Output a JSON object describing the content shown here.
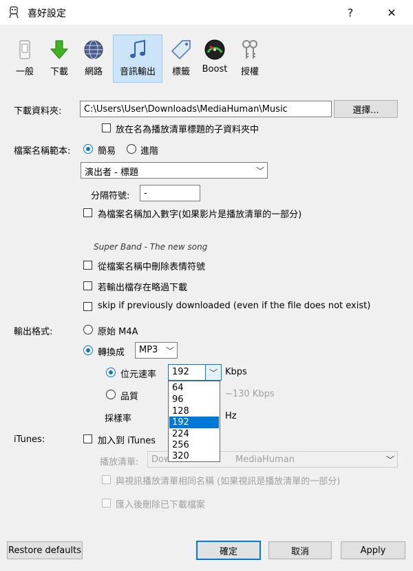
{
  "window": {
    "title": "喜好設定",
    "help_glyph": "?",
    "close_glyph": "✕"
  },
  "toolbar": [
    {
      "label": "一般",
      "icon": "toggle-switch-icon"
    },
    {
      "label": "下載",
      "icon": "download-arrow-icon"
    },
    {
      "label": "網路",
      "icon": "globe-icon"
    },
    {
      "label": "音訊輸出",
      "icon": "music-note-icon",
      "selected": true
    },
    {
      "label": "標籤",
      "icon": "tag-icon"
    },
    {
      "label": "Boost",
      "icon": "speedometer-icon"
    },
    {
      "label": "授權",
      "icon": "keys-icon"
    }
  ],
  "download_folder": {
    "label": "下載資料夾:",
    "path": "C:\\Users\\User\\Downloads\\MediaHuman\\Music",
    "browse_label": "選擇...",
    "subfolder_label": "放在名為播放清單標題的子資料夾中"
  },
  "filename_template": {
    "label": "檔案名稱範本:",
    "simple_label": "簡易",
    "advanced_label": "進階",
    "pattern_value": "演出者 - 標題",
    "separator_label": "分隔符號:",
    "separator_value": "-",
    "add_number_label": "為檔案名稱加入數字(如果影片是播放清單的一部分)",
    "preview": "Super Band - The new song"
  },
  "options": {
    "remove_emoji_label": "從檔案名稱中刪除表情符號",
    "skip_exists_label": "若輸出檔存在略過下載",
    "skip_prev_label": "skip if previously downloaded (even if the file does not exist)"
  },
  "output_format": {
    "label": "輸出格式:",
    "original_label": "原始 M4A",
    "convert_label": "轉換成",
    "format_value": "MP3",
    "bitrate_label": "位元速率",
    "bitrate_value": "192",
    "kbps_label": "Kbps",
    "quality_label": "品質",
    "quality_hint": "~130 Kbps",
    "samplerate_label": "採樣率",
    "hz_label": "Hz",
    "bitrate_options": [
      "64",
      "96",
      "128",
      "192",
      "224",
      "256",
      "320"
    ],
    "selected_bitrate": "192"
  },
  "itunes": {
    "label": "iTunes:",
    "add_label": "加入到 iTunes",
    "playlist_label": "播放清單:",
    "playlist_value_left": "Dow",
    "playlist_value_right": "MediaHuman",
    "same_name_label": "與視訊播放清單相同名稱 (如果視訊是播放清單的一部分)",
    "delete_after_label": "匯入後刪除已下載檔案"
  },
  "footer": {
    "restore_label": "Restore defaults",
    "ok_label": "確定",
    "cancel_label": "取消",
    "apply_label": "Apply"
  },
  "colors": {
    "accent": "#0078d7",
    "selected_tab_bg": "#cce4f7",
    "dialog_bg": "#f0f0f0"
  }
}
